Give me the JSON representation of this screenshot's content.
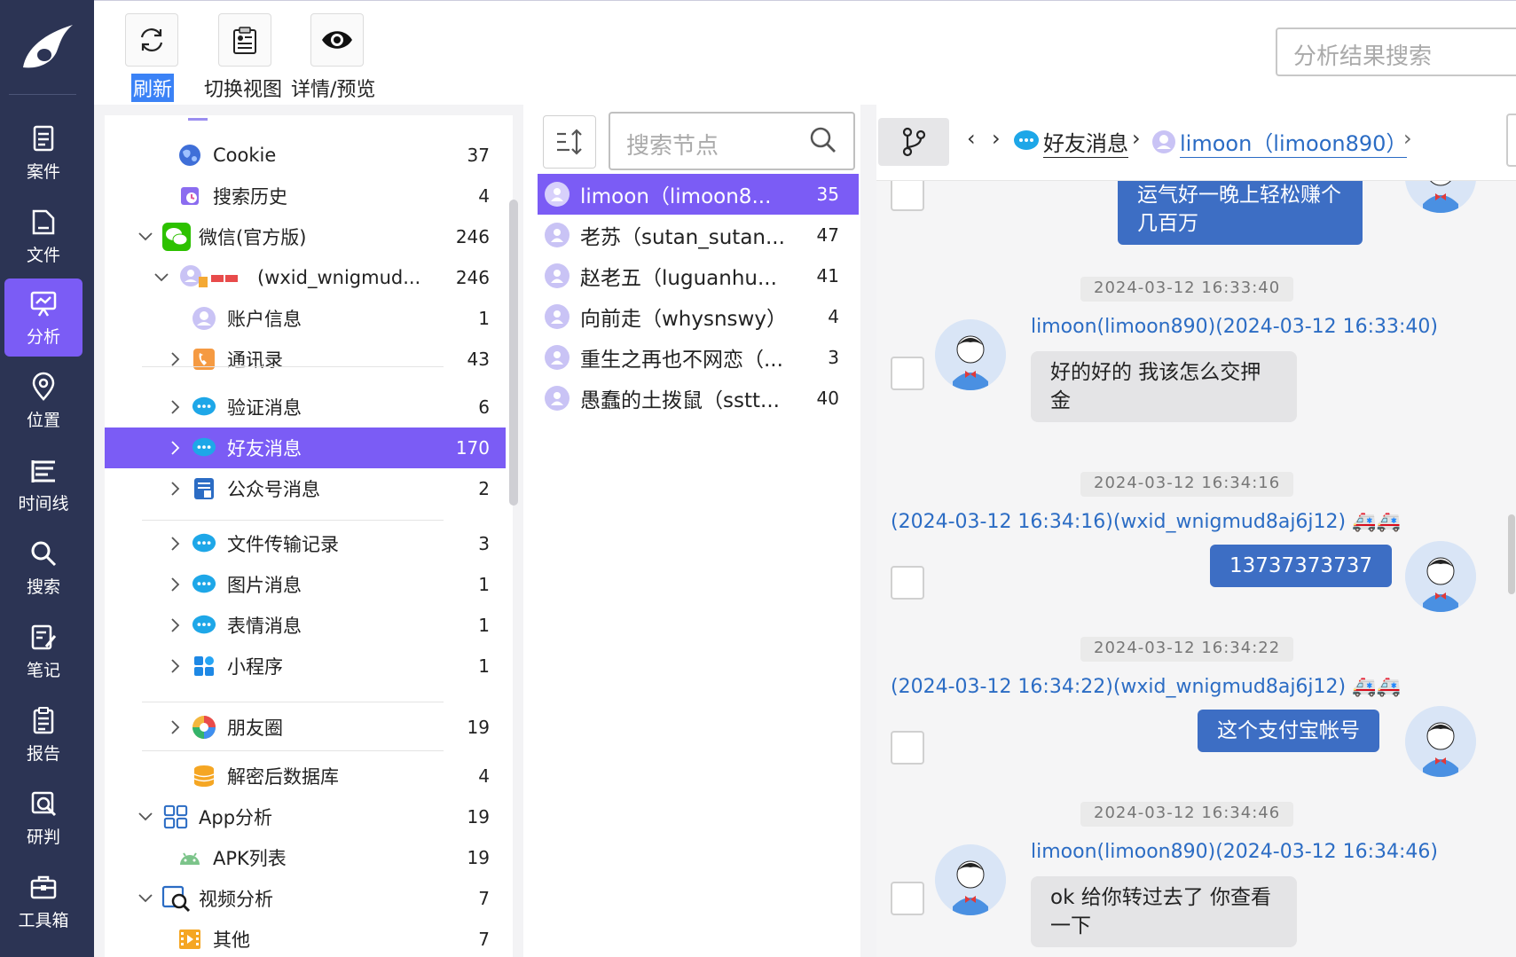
{
  "nav": {
    "items": [
      {
        "label": "案件",
        "icon": "case-icon"
      },
      {
        "label": "文件",
        "icon": "file-icon"
      },
      {
        "label": "分析",
        "icon": "analysis-icon"
      },
      {
        "label": "位置",
        "icon": "location-icon"
      },
      {
        "label": "时间线",
        "icon": "timeline-icon"
      },
      {
        "label": "搜索",
        "icon": "search-icon"
      },
      {
        "label": "笔记",
        "icon": "note-icon"
      },
      {
        "label": "报告",
        "icon": "report-icon"
      },
      {
        "label": "研判",
        "icon": "judge-icon"
      },
      {
        "label": "工具箱",
        "icon": "toolbox-icon"
      }
    ],
    "active_index": 2
  },
  "toolbar": {
    "refresh_label": "刷新",
    "switch_view_label": "切换视图",
    "detail_preview_label": "详情/预览",
    "search_placeholder": "分析结果搜索"
  },
  "tree": {
    "rows": [
      {
        "label": "Cookie",
        "count": "37",
        "icon": "cookie-icon"
      },
      {
        "label": "搜索历史",
        "count": "4",
        "icon": "search-history-icon"
      },
      {
        "label": "微信(官方版)",
        "count": "246",
        "icon": "wechat-icon"
      },
      {
        "label": "(wxid_wnigmud...",
        "count": "246",
        "icon": "account-avatar-icon"
      },
      {
        "label": "账户信息",
        "count": "1",
        "icon": "user-icon"
      },
      {
        "label": "通讯录",
        "count": "43",
        "icon": "contacts-icon"
      },
      {
        "label": "验证消息",
        "count": "6",
        "icon": "message-icon"
      },
      {
        "label": "好友消息",
        "count": "170",
        "icon": "message-icon"
      },
      {
        "label": "公众号消息",
        "count": "2",
        "icon": "official-account-icon"
      },
      {
        "label": "文件传输记录",
        "count": "3",
        "icon": "message-icon"
      },
      {
        "label": "图片消息",
        "count": "1",
        "icon": "message-icon"
      },
      {
        "label": "表情消息",
        "count": "1",
        "icon": "message-icon"
      },
      {
        "label": "小程序",
        "count": "1",
        "icon": "mini-program-icon"
      },
      {
        "label": "朋友圈",
        "count": "19",
        "icon": "moments-icon"
      },
      {
        "label": "解密后数据库",
        "count": "4",
        "icon": "database-icon"
      },
      {
        "label": "App分析",
        "count": "19",
        "icon": "app-grid-icon"
      },
      {
        "label": "APK列表",
        "count": "19",
        "icon": "android-icon"
      },
      {
        "label": "视频分析",
        "count": "7",
        "icon": "video-analysis-icon"
      },
      {
        "label": "其他",
        "count": "7",
        "icon": "film-icon"
      }
    ]
  },
  "nodes": {
    "search_placeholder": "搜索节点",
    "items": [
      {
        "name": "limoon（limoon8...",
        "count": "35"
      },
      {
        "name": "老苏（sutan_sutan...",
        "count": "47"
      },
      {
        "name": "赵老五（luguanhu...",
        "count": "41"
      },
      {
        "name": "向前走（whysnswy）",
        "count": "4"
      },
      {
        "name": "重生之再也不网恋（...",
        "count": "3"
      },
      {
        "name": "愚蠢的土拨鼠（sstt...",
        "count": "40"
      }
    ]
  },
  "chat": {
    "breadcrumb": {
      "level1": "好友消息",
      "level2": "limoon（limoon890）"
    },
    "messages": [
      {
        "side": "right",
        "text": "运气好一晚上轻松赚个几百万"
      },
      {
        "timestamp": "2024-03-12 16:33:40",
        "meta": "limoon(limoon890)(2024-03-12 16:33:40)",
        "side": "left",
        "text": "好的好的 我该怎么交押金"
      },
      {
        "timestamp": "2024-03-12 16:34:16",
        "meta": "(2024-03-12 16:34:16)(wxid_wnigmud8aj6j12)",
        "side": "right",
        "text": "13737373737"
      },
      {
        "timestamp": "2024-03-12 16:34:22",
        "meta": "(2024-03-12 16:34:22)(wxid_wnigmud8aj6j12)",
        "side": "right",
        "text": "这个支付宝帐号"
      },
      {
        "timestamp": "2024-03-12 16:34:46",
        "meta": "limoon(limoon890)(2024-03-12 16:34:46)",
        "side": "left",
        "text": "ok 给你转过去了 你查看一下"
      }
    ]
  },
  "colors": {
    "nav_bg": "#2c3454",
    "accent": "#7b5cf5",
    "link": "#2b6cc4",
    "bubble_self": "#3d6ec4"
  }
}
